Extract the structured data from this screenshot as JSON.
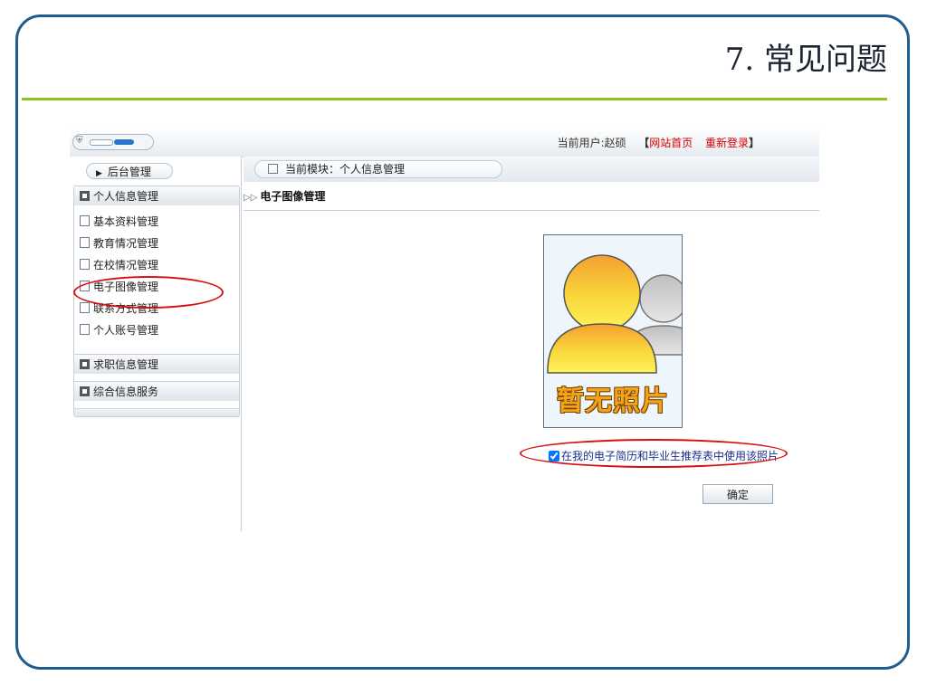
{
  "slide": {
    "title": "7. 常见问题"
  },
  "topbar": {
    "user_prefix": "当前用户:",
    "user_name": "赵硕",
    "bracket_open": "【",
    "home_link": "网站首页",
    "relogin_link": "重新登录",
    "bracket_close": "】"
  },
  "sidebar": {
    "header": "后台管理",
    "sections": [
      {
        "label": "个人信息管理",
        "items": [
          "基本资料管理",
          "教育情况管理",
          "在校情况管理",
          "电子图像管理",
          "联系方式管理",
          "个人账号管理"
        ]
      },
      {
        "label": "求职信息管理"
      },
      {
        "label": "综合信息服务"
      }
    ]
  },
  "main": {
    "breadcrumb": "当前模块：个人信息管理",
    "section_title": "电子图像管理",
    "photo_placeholder": "暂无照片",
    "checkbox_label": "在我的电子简历和毕业生推荐表中使用该照片",
    "checkbox_checked": true,
    "confirm_label": "确定"
  },
  "colors": {
    "frame": "#1f5d8f",
    "title_rule": "#8dc21f",
    "highlight_ellipse": "#d60f0f",
    "link_red": "#d40000"
  }
}
